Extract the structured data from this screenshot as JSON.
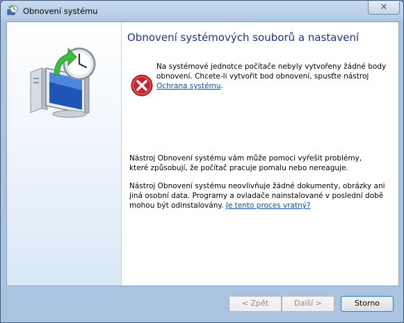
{
  "window": {
    "title": "Obnovení systému",
    "close_glyph": "✕"
  },
  "main": {
    "heading": "Obnovení systémových souborů a nastavení",
    "error_message": "Na systémové jednotce počítače nebyly vytvořeny žádné body obnovení. Chcete-li vytvořit bod obnovení, spusťte nástroj ",
    "error_link": "Ochrana systému",
    "error_suffix": ".",
    "info1": "Nástroj Obnovení systému vám může pomoci vyřešit problémy, které způsobují, že počítač pracuje pomalu nebo nereaguje.",
    "info2": "Nástroj Obnovení systému neovlivňuje žádné dokumenty, obrázky ani jiná osobní data. Programy a ovladače nainstalované v poslední době mohou být odinstalovány. ",
    "info2_link": "Je tento proces vratný?"
  },
  "buttons": {
    "back": "< Zpět",
    "next": "Další >",
    "cancel": "Storno"
  },
  "icons": {
    "title": "system-restore-icon",
    "hero": "system-restore-computer-icon",
    "error": "error-icon"
  },
  "colors": {
    "heading": "#1e3287",
    "link": "#0b4ea2",
    "error_red": "#c8242b"
  }
}
